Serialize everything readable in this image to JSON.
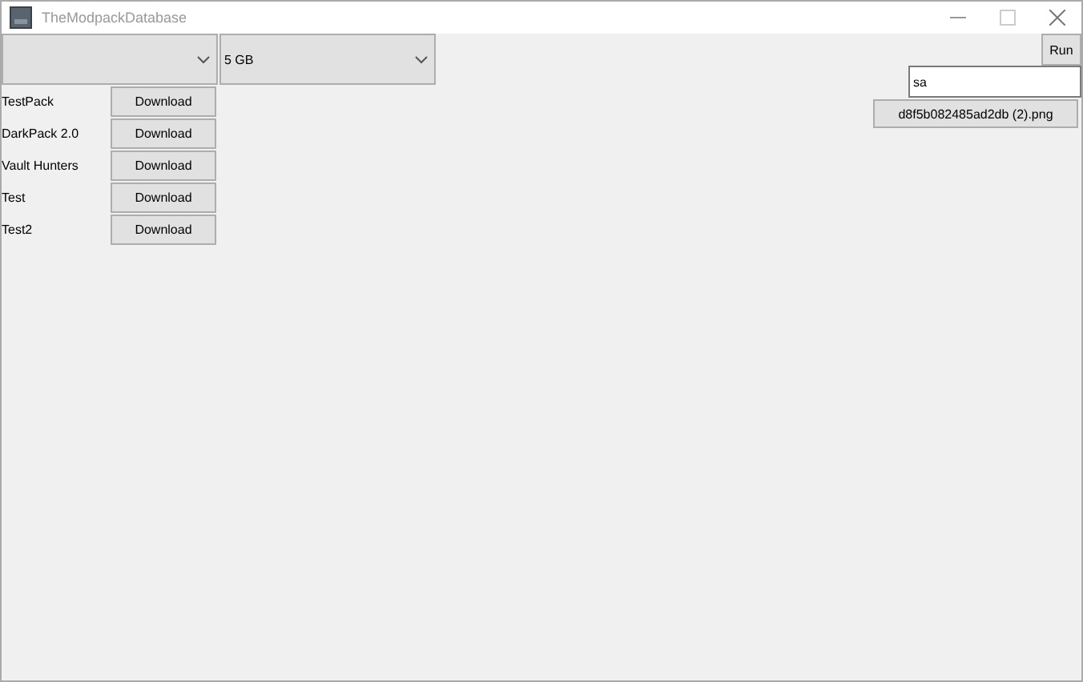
{
  "window": {
    "title": "TheModpackDatabase"
  },
  "size_dropdown": {
    "value": "5 GB"
  },
  "modpacks": [
    {
      "name": "TestPack",
      "button": "Download"
    },
    {
      "name": "DarkPack 2.0",
      "button": "Download"
    },
    {
      "name": "Vault Hunters",
      "button": "Download"
    },
    {
      "name": "Test",
      "button": "Download"
    },
    {
      "name": "Test2",
      "button": "Download"
    }
  ],
  "run_button": "Run",
  "search": {
    "value": "sa"
  },
  "file_button": "d8f5b082485ad2db (2).png"
}
